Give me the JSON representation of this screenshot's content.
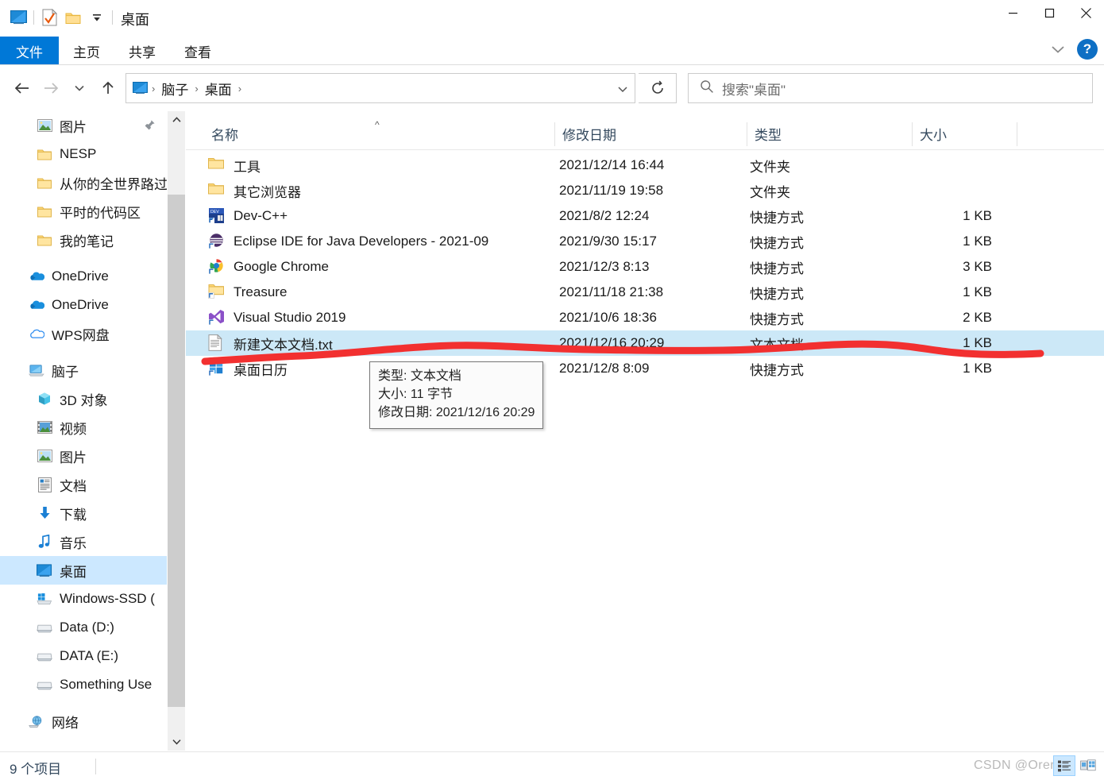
{
  "window": {
    "title": "桌面",
    "quick_access": [
      "desktop-icon",
      "properties-icon",
      "new-folder-icon",
      "customize-dropdown-icon"
    ],
    "controls": {
      "minimize": "—",
      "maximize": "□",
      "close": "✕"
    }
  },
  "ribbon": {
    "tabs": [
      {
        "label": "文件",
        "active": true
      },
      {
        "label": "主页",
        "active": false
      },
      {
        "label": "共享",
        "active": false
      },
      {
        "label": "查看",
        "active": false
      }
    ],
    "help_label": "?"
  },
  "address_bar": {
    "back": "←",
    "forward": "→",
    "recent": "⌄",
    "up": "↑",
    "breadcrumbs": [
      "脑子",
      "桌面"
    ],
    "separator": "›",
    "refresh": "↻"
  },
  "search": {
    "placeholder": "搜索\"桌面\"",
    "icon": "search-icon"
  },
  "nav_pane": {
    "groups": [
      {
        "items": [
          {
            "label": "图片",
            "icon": "pictures-icon",
            "pinned": true,
            "indent": "child"
          },
          {
            "label": "NESP",
            "icon": "folder-icon",
            "indent": "child"
          },
          {
            "label": "从你的全世界路过",
            "icon": "folder-icon",
            "indent": "child"
          },
          {
            "label": "平时的代码区",
            "icon": "folder-icon",
            "indent": "child"
          },
          {
            "label": "我的笔记",
            "icon": "folder-icon",
            "indent": "child"
          }
        ]
      },
      {
        "items": [
          {
            "label": "OneDrive",
            "icon": "onedrive-icon",
            "indent": "root"
          },
          {
            "label": "OneDrive",
            "icon": "onedrive-icon",
            "indent": "root"
          },
          {
            "label": "WPS网盘",
            "icon": "wps-cloud-icon",
            "indent": "root"
          }
        ]
      },
      {
        "items": [
          {
            "label": "脑子",
            "icon": "this-pc-icon",
            "indent": "root"
          },
          {
            "label": "3D 对象",
            "icon": "3d-objects-icon",
            "indent": "child"
          },
          {
            "label": "视频",
            "icon": "videos-icon",
            "indent": "child"
          },
          {
            "label": "图片",
            "icon": "pictures-icon",
            "indent": "child"
          },
          {
            "label": "文档",
            "icon": "documents-icon",
            "indent": "child"
          },
          {
            "label": "下载",
            "icon": "downloads-icon",
            "indent": "child"
          },
          {
            "label": "音乐",
            "icon": "music-icon",
            "indent": "child"
          },
          {
            "label": "桌面",
            "icon": "desktop-icon",
            "indent": "child",
            "selected": true
          },
          {
            "label": "Windows-SSD (",
            "icon": "windows-drive-icon",
            "indent": "child"
          },
          {
            "label": "Data (D:)",
            "icon": "drive-icon",
            "indent": "child"
          },
          {
            "label": "DATA (E:)",
            "icon": "drive-icon",
            "indent": "child"
          },
          {
            "label": "Something Use",
            "icon": "drive-icon",
            "indent": "child"
          }
        ]
      },
      {
        "items": [
          {
            "label": "网络",
            "icon": "network-icon",
            "indent": "root"
          }
        ]
      }
    ]
  },
  "file_list": {
    "columns": [
      {
        "label": "名称",
        "key": "name",
        "sorted": true
      },
      {
        "label": "修改日期",
        "key": "date"
      },
      {
        "label": "类型",
        "key": "type"
      },
      {
        "label": "大小",
        "key": "size"
      }
    ],
    "sort_indicator": "^",
    "rows": [
      {
        "name": "工具",
        "date": "2021/12/14 16:44",
        "type": "文件夹",
        "size": "",
        "icon": "folder-icon"
      },
      {
        "name": "其它浏览器",
        "date": "2021/11/19 19:58",
        "type": "文件夹",
        "size": "",
        "icon": "folder-icon"
      },
      {
        "name": "Dev-C++",
        "date": "2021/8/2 12:24",
        "type": "快捷方式",
        "size": "1 KB",
        "icon": "devcpp-icon"
      },
      {
        "name": "Eclipse IDE for Java Developers - 2021-09",
        "date": "2021/9/30 15:17",
        "type": "快捷方式",
        "size": "1 KB",
        "icon": "eclipse-icon"
      },
      {
        "name": "Google Chrome",
        "date": "2021/12/3 8:13",
        "type": "快捷方式",
        "size": "3 KB",
        "icon": "chrome-icon"
      },
      {
        "name": "Treasure",
        "date": "2021/11/18 21:38",
        "type": "快捷方式",
        "size": "1 KB",
        "icon": "folder-shortcut-icon"
      },
      {
        "name": "Visual Studio 2019",
        "date": "2021/10/6 18:36",
        "type": "快捷方式",
        "size": "2 KB",
        "icon": "visualstudio-icon"
      },
      {
        "name": "新建文本文档.txt",
        "date": "2021/12/16 20:29",
        "type": "文本文档",
        "size": "1 KB",
        "icon": "textfile-icon",
        "selected": true
      },
      {
        "name": "桌面日历",
        "date": "2021/12/8 8:09",
        "type": "快捷方式",
        "size": "1 KB",
        "icon": "calendar-tiles-icon"
      }
    ]
  },
  "tooltip": {
    "lines": [
      "类型: 文本文档",
      "大小: 11 字节",
      "修改日期: 2021/12/16 20:29"
    ]
  },
  "status_bar": {
    "item_count": "9 个项目",
    "watermark": "CSDN @Orer",
    "view_buttons": [
      {
        "name": "details-view",
        "active": true
      },
      {
        "name": "large-icons-view",
        "active": false
      }
    ]
  },
  "colors": {
    "accent": "#0078d7",
    "selection": "#cce8f7",
    "nav_selection": "#cce8ff",
    "annotation": "#f03030",
    "header_text": "#34495e"
  }
}
